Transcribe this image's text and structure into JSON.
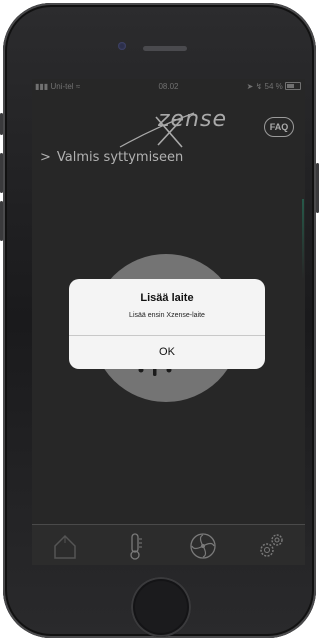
{
  "statusbar": {
    "carrier": "Uni-tel",
    "time": "08.02",
    "battery": "54 %"
  },
  "header": {
    "logo": "zense",
    "faq_label": "FAQ"
  },
  "main": {
    "status_text": "Valmis syttymiseen"
  },
  "alert": {
    "title": "Lisää laite",
    "message": "Lisää ensin Xzense-laite",
    "ok_label": "OK"
  },
  "tabbar": {
    "tabs": [
      {
        "icon": "home-icon"
      },
      {
        "icon": "thermometer-icon"
      },
      {
        "icon": "fan-icon"
      },
      {
        "icon": "gears-icon"
      }
    ]
  },
  "colors": {
    "background": "#303030",
    "alert_bg": "#f4f4f4",
    "text_light": "#d8d8d8"
  }
}
